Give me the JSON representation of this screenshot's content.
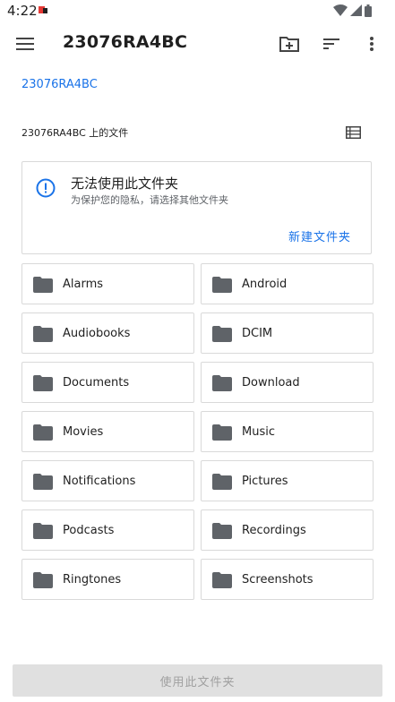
{
  "status_bar": {
    "time": "4:22"
  },
  "toolbar": {
    "title": "23076RA4BC"
  },
  "breadcrumb": {
    "root": "23076RA4BC"
  },
  "section": {
    "label": "23076RA4BC 上的文件"
  },
  "warning": {
    "title": "无法使用此文件夹",
    "subtitle": "为保护您的隐私，请选择其他文件夹",
    "action": "新建文件夹"
  },
  "folders": [
    {
      "name": "Alarms"
    },
    {
      "name": "Android"
    },
    {
      "name": "Audiobooks"
    },
    {
      "name": "DCIM"
    },
    {
      "name": "Documents"
    },
    {
      "name": "Download"
    },
    {
      "name": "Movies"
    },
    {
      "name": "Music"
    },
    {
      "name": "Notifications"
    },
    {
      "name": "Pictures"
    },
    {
      "name": "Podcasts"
    },
    {
      "name": "Recordings"
    },
    {
      "name": "Ringtones"
    },
    {
      "name": "Screenshots"
    }
  ],
  "bottom_button": {
    "label": "使用此文件夹"
  },
  "colors": {
    "accent": "#1a73e8",
    "border": "#d9d9d9",
    "folder_icon": "#5f6368"
  }
}
